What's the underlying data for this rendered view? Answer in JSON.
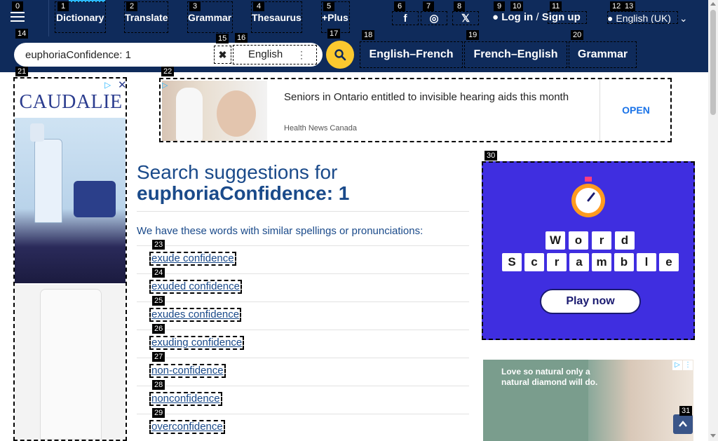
{
  "nav": {
    "links": [
      {
        "label": "Dictionary",
        "badge": "1"
      },
      {
        "label": "Translate",
        "badge": "2"
      },
      {
        "label": "Grammar",
        "badge": "3"
      },
      {
        "label": "Thesaurus",
        "badge": "4"
      },
      {
        "label": "+Plus",
        "badge": "5"
      }
    ],
    "menu_badge": "0",
    "social": [
      {
        "icon": "facebook-icon",
        "glyph": "f",
        "badge": "6"
      },
      {
        "icon": "instagram-icon",
        "glyph": "◎",
        "badge": "7"
      },
      {
        "icon": "x-icon",
        "glyph": "𝕏",
        "badge": "8"
      }
    ],
    "login": {
      "login_label": "Log in",
      "separator": "/",
      "signup_label": "Sign up",
      "badge_user": "9",
      "badge_login": "10",
      "badge_signup": "11"
    },
    "language": {
      "label": "English (UK)",
      "badge_a": "12",
      "badge_b": "13"
    }
  },
  "search": {
    "value": "euphoriaConfidence: 1",
    "language": "English",
    "badge_input": "14",
    "badge_clear": "15",
    "badge_lang": "16",
    "badge_button": "17",
    "tabs": [
      {
        "label": "English–French",
        "badge": "18"
      },
      {
        "label": "French–English",
        "badge": "19"
      },
      {
        "label": "Grammar",
        "badge": "20"
      }
    ]
  },
  "ads": {
    "left": {
      "brand": "CAUDALIE",
      "badge": "21"
    },
    "banner": {
      "title": "Seniors in Ontario entitled to invisible hearing aids this month",
      "source": "Health News Canada",
      "cta": "OPEN",
      "badge": "22"
    },
    "game": {
      "row1": [
        "W",
        "o",
        "r",
        "d"
      ],
      "row2": [
        "S",
        "c",
        "r",
        "a",
        "m",
        "b",
        "l",
        "e"
      ],
      "cta": "Play now",
      "badge": "30"
    },
    "diamond": {
      "text": "Love so natural only a natural diamond will do."
    }
  },
  "main": {
    "title_prefix": "Search suggestions for",
    "title_term": "euphoriaConfidence: 1",
    "intro": "We have these words with similar spellings or pronunciations:",
    "suggestions": [
      {
        "text": "exude confidence",
        "badge": "23"
      },
      {
        "text": "exuded confidence",
        "badge": "24"
      },
      {
        "text": "exudes confidence",
        "badge": "25"
      },
      {
        "text": "exuding confidence",
        "badge": "26"
      },
      {
        "text": "non-confidence",
        "badge": "27"
      },
      {
        "text": "nonconfidence",
        "badge": "28"
      },
      {
        "text": "overconfidence",
        "badge": "29"
      }
    ]
  },
  "scroll_top_badge": "31",
  "colors": {
    "nav_bg": "#0f2b5b",
    "accent_blue": "#2bb7ff",
    "search_button": "#fbc92f",
    "link": "#1a4a8a",
    "game_bg": "#3f2ee0"
  }
}
